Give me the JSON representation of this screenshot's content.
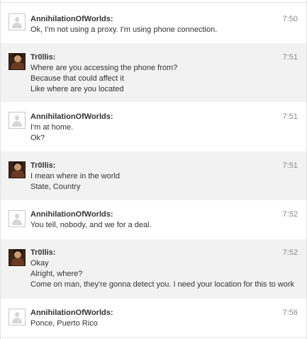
{
  "messages": [
    {
      "author": "AnnihilationOfWorlds:",
      "time": "7:50",
      "avatar": "default-user-icon",
      "lines": [
        "Ok, I'm not using a proxy. I'm using phone connection."
      ]
    },
    {
      "author": "Tr0llis:",
      "time": "7:51",
      "avatar": "user-photo",
      "lines": [
        "Where are you accessing the phone from?",
        "Because that could affect it",
        "Like where are you located"
      ]
    },
    {
      "author": "AnnihilationOfWorlds:",
      "time": "7:51",
      "avatar": "default-user-icon",
      "lines": [
        "I'm at home.",
        "Ok?"
      ]
    },
    {
      "author": "Tr0llis:",
      "time": "7:51",
      "avatar": "user-photo",
      "lines": [
        "I mean where in the world",
        "State, Country"
      ]
    },
    {
      "author": "AnnihilationOfWorlds:",
      "time": "7:52",
      "avatar": "default-user-icon",
      "lines": [
        "You tell, nobody, and we for a deal."
      ]
    },
    {
      "author": "Tr0llis:",
      "time": "7:52",
      "avatar": "user-photo",
      "lines": [
        "Okay",
        "Alright, where?",
        "Come on man, they're gonna detect you. I need your location for this to work"
      ]
    },
    {
      "author": "AnnihilationOfWorlds:",
      "time": "7:56",
      "avatar": "default-user-icon",
      "lines": [
        "Ponce, Puerto Rico"
      ]
    }
  ],
  "colors": {
    "alt_row": "#f2f2f2",
    "text": "#333333",
    "time": "#888888",
    "border": "#e3e3e3"
  }
}
